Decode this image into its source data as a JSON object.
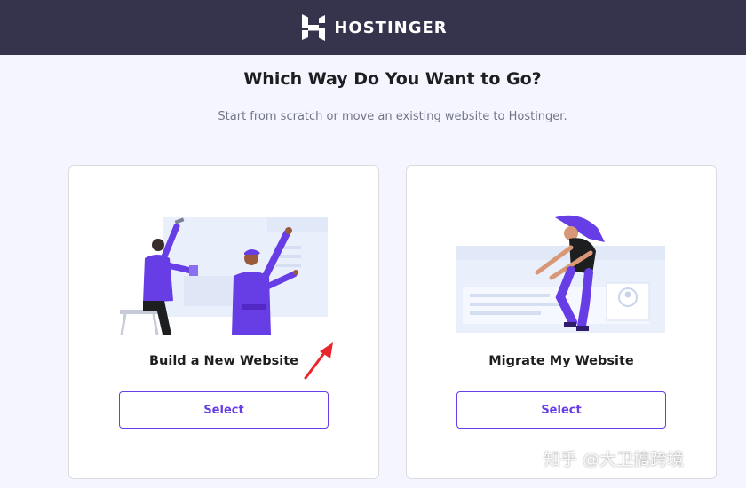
{
  "header": {
    "brand_name": "HOSTINGER"
  },
  "main": {
    "title": "Which Way Do You Want to Go?",
    "subtitle": "Start from scratch or move an existing website to Hostinger."
  },
  "cards": [
    {
      "title": "Build a New Website",
      "button_label": "Select",
      "illustration": "people-building-website"
    },
    {
      "title": "Migrate My Website",
      "button_label": "Select",
      "illustration": "person-moving-website"
    }
  ],
  "annotation": {
    "icon": "red-arrow-pointer",
    "color": "#e8262b"
  },
  "watermark": "知乎 @大卫搞跨境",
  "colors": {
    "header_bg": "#36344d",
    "accent": "#673de6",
    "page_bg": "#f4f5ff"
  }
}
